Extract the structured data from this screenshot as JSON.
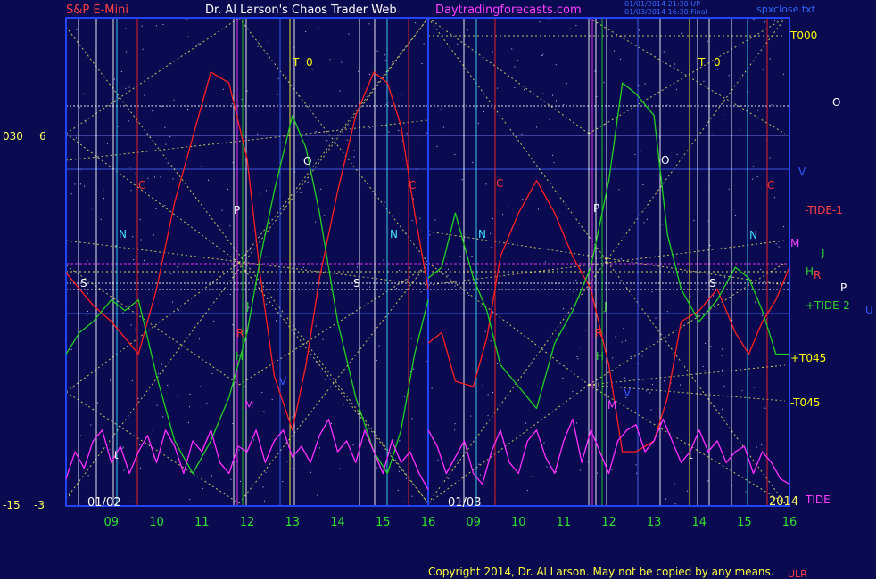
{
  "header": {
    "instrument": "S&P E-Mini",
    "site_title": "Dr. Al Larson's Chaos Trader Web",
    "site_url": "Daytradingforecasts.com",
    "stamp_line1": "01/01/2014 21:30 UP",
    "stamp_line2": "01/03/2014 16:30 Final",
    "file_name": "spxclose.txt"
  },
  "footer": {
    "copyright": "Copyright 2014, Dr. Al Larson. May not be copied by any means."
  },
  "colors": {
    "background": "#0a0a50",
    "axes": "#2244ff",
    "price": "#ff2020",
    "flux": "#20d020",
    "tide": "#ff30ff",
    "grid_lines": "#ffff60"
  },
  "left_axis": {
    "top_outer": "030",
    "top_inner": "6",
    "bottom_outer": "-15",
    "bottom_inner": "-3"
  },
  "session_labels": [
    "01/02",
    "01/03"
  ],
  "year_label": "2014",
  "corner_label": "ULR",
  "right_labels": [
    {
      "text": "T000",
      "color": "#ffff00"
    },
    {
      "text": "O",
      "color": "#ffffff"
    },
    {
      "text": "V",
      "color": "#3355ff"
    },
    {
      "text": "-TIDE-1",
      "color": "#ff4040"
    },
    {
      "text": "M",
      "color": "#ff40ff"
    },
    {
      "text": "J",
      "color": "#30d030"
    },
    {
      "text": "H",
      "color": "#30d030"
    },
    {
      "text": "R",
      "color": "#ff4040"
    },
    {
      "text": "P",
      "color": "#ffffff"
    },
    {
      "text": "+TIDE-2",
      "color": "#30d030"
    },
    {
      "text": "U",
      "color": "#3355ff"
    },
    {
      "text": "+T045",
      "color": "#ffff00"
    },
    {
      "text": "-T045",
      "color": "#ffff00"
    },
    {
      "text": "TIDE",
      "color": "#ff40ff"
    }
  ],
  "marker_labels": [
    {
      "text": "S&P E-Mini"
    },
    {
      "text": "T",
      "color": "#ffff00"
    },
    {
      "text": "0",
      "color": "#ffff00"
    },
    {
      "text": "T",
      "color": "#ffff00"
    },
    {
      "text": "0",
      "color": "#ffff00"
    },
    {
      "text": "O",
      "color": "#ffffff"
    },
    {
      "text": "O",
      "color": "#ffffff"
    },
    {
      "text": "C",
      "color": "#ff3030"
    },
    {
      "text": "C",
      "color": "#ff3030"
    },
    {
      "text": "C",
      "color": "#ff3030"
    },
    {
      "text": "C",
      "color": "#ff3030"
    },
    {
      "text": "P",
      "color": "#ffffff"
    },
    {
      "text": "P",
      "color": "#ffffff"
    },
    {
      "text": "N",
      "color": "#40e0ff"
    },
    {
      "text": "N",
      "color": "#40e0ff"
    },
    {
      "text": "N",
      "color": "#40e0ff"
    },
    {
      "text": "N",
      "color": "#40e0ff"
    },
    {
      "text": "S",
      "color": "#ffffff"
    },
    {
      "text": "S",
      "color": "#ffffff"
    },
    {
      "text": "S",
      "color": "#ffffff"
    },
    {
      "text": "J",
      "color": "#30d030"
    },
    {
      "text": "J",
      "color": "#30d030"
    },
    {
      "text": "R",
      "color": "#ff3030"
    },
    {
      "text": "R",
      "color": "#ff3030"
    },
    {
      "text": "H",
      "color": "#30d030"
    },
    {
      "text": "H",
      "color": "#30d030"
    },
    {
      "text": "M",
      "color": "#ff40ff"
    },
    {
      "text": "M",
      "color": "#ff40ff"
    },
    {
      "text": "V",
      "color": "#3355ff"
    },
    {
      "text": "V",
      "color": "#3355ff"
    },
    {
      "text": "t",
      "color": "#ffffff"
    },
    {
      "text": "t",
      "color": "#ffffff"
    }
  ],
  "chart_data": {
    "type": "line",
    "x_ticks": [
      "09",
      "10",
      "11",
      "12",
      "13",
      "14",
      "15",
      "16",
      "09",
      "10",
      "11",
      "12",
      "13",
      "14",
      "15",
      "16"
    ],
    "sessions": [
      "01/02",
      "01/03"
    ],
    "ylim": [
      -15,
      30
    ],
    "series": [
      {
        "name": "TIDE-1",
        "color": "#ff2020",
        "x": [
          8.0,
          8.3,
          8.6,
          9.0,
          9.3,
          9.6,
          10.0,
          10.4,
          10.8,
          11.2,
          11.6,
          12.0,
          12.3,
          12.6,
          13.0,
          13.3,
          13.6,
          14.0,
          14.4,
          14.8,
          15.1,
          15.4,
          15.7,
          16.0
        ],
        "y": [
          6.5,
          5,
          3.5,
          2,
          0.5,
          -1,
          5,
          13,
          19,
          25,
          24,
          17,
          6,
          -3,
          -8,
          -2,
          6,
          14,
          21,
          25,
          24,
          20,
          12,
          5
        ]
      },
      {
        "name": "TIDE-1 (01/03)",
        "color": "#ff2020",
        "x": [
          8.0,
          8.3,
          8.6,
          9.0,
          9.3,
          9.6,
          10.0,
          10.4,
          10.8,
          11.2,
          11.6,
          12.0,
          12.3,
          12.6,
          13.0,
          13.3,
          13.6,
          14.0,
          14.4,
          14.8,
          15.1,
          15.4,
          15.7,
          16.0
        ],
        "y": [
          0,
          1,
          -3.5,
          -4,
          0.5,
          8,
          12,
          15,
          12,
          8,
          5,
          -2,
          -10,
          -10,
          -9,
          -5,
          2,
          3,
          5,
          1,
          -1,
          2,
          4,
          7
        ]
      },
      {
        "name": "TIDE-2",
        "color": "#20d020",
        "x": [
          8.0,
          8.3,
          8.6,
          9.0,
          9.3,
          9.6,
          10.0,
          10.4,
          10.8,
          11.2,
          11.6,
          12.0,
          12.3,
          12.6,
          13.0,
          13.3,
          13.6,
          14.0,
          14.4,
          14.8,
          15.1,
          15.4,
          15.7,
          16.0
        ],
        "y": [
          -1,
          1,
          2,
          4,
          3,
          4,
          -3,
          -9,
          -12,
          -9,
          -5,
          1,
          8,
          14,
          21,
          18,
          12,
          2,
          -5,
          -10,
          -12,
          -8,
          -1,
          4
        ]
      },
      {
        "name": "TIDE-2 (01/03)",
        "color": "#20d020",
        "x": [
          8.0,
          8.3,
          8.6,
          9.0,
          9.3,
          9.6,
          10.0,
          10.4,
          10.8,
          11.2,
          11.6,
          12.0,
          12.3,
          12.6,
          13.0,
          13.3,
          13.6,
          14.0,
          14.4,
          14.8,
          15.1,
          15.4,
          15.7,
          16.0
        ],
        "y": [
          6,
          7,
          12,
          6,
          3,
          -2,
          -4,
          -6,
          0,
          3,
          7,
          15,
          24,
          23,
          21,
          10,
          5,
          2,
          4,
          7,
          6,
          3,
          -1,
          -1
        ]
      },
      {
        "name": "TIDE",
        "color": "#ff30ff",
        "x": [
          8.0,
          8.2,
          8.4,
          8.6,
          8.8,
          9.0,
          9.2,
          9.4,
          9.6,
          9.8,
          10.0,
          10.2,
          10.4,
          10.6,
          10.8,
          11.0,
          11.2,
          11.4,
          11.6,
          11.8,
          12.0,
          12.2,
          12.4,
          12.6,
          12.8,
          13.0,
          13.2,
          13.4,
          13.6,
          13.8,
          14.0,
          14.2,
          14.4,
          14.6,
          14.8,
          15.0,
          15.2,
          15.4,
          15.6,
          15.8,
          16.0
        ],
        "y": [
          -12.5,
          -10,
          -11.5,
          -9,
          -8,
          -11,
          -9.5,
          -12,
          -10,
          -8.5,
          -11,
          -8,
          -9.5,
          -12,
          -9,
          -10,
          -8,
          -11,
          -12,
          -9.5,
          -10,
          -8,
          -11,
          -9,
          -8,
          -10.5,
          -9.5,
          -11,
          -8.5,
          -7,
          -10,
          -9,
          -11,
          -8,
          -10,
          -12,
          -9,
          -11,
          -10,
          -12,
          -13.5
        ]
      },
      {
        "name": "TIDE (01/03)",
        "color": "#ff30ff",
        "x": [
          8.0,
          8.2,
          8.4,
          8.6,
          8.8,
          9.0,
          9.2,
          9.4,
          9.6,
          9.8,
          10.0,
          10.2,
          10.4,
          10.6,
          10.8,
          11.0,
          11.2,
          11.4,
          11.6,
          11.8,
          12.0,
          12.2,
          12.4,
          12.6,
          12.8,
          13.0,
          13.2,
          13.4,
          13.6,
          13.8,
          14.0,
          14.2,
          14.4,
          14.6,
          14.8,
          15.0,
          15.2,
          15.4,
          15.6,
          15.8,
          16.0
        ],
        "y": [
          -8,
          -9.5,
          -12,
          -10.5,
          -9,
          -12,
          -13,
          -10,
          -8,
          -11,
          -12,
          -9,
          -8,
          -10.5,
          -12,
          -9,
          -7,
          -11,
          -8,
          -10,
          -12,
          -9,
          -8,
          -7.5,
          -10,
          -9,
          -7,
          -9,
          -11,
          -10,
          -8,
          -10,
          -9,
          -11,
          -10,
          -9.5,
          -12,
          -10,
          -11,
          -12.5,
          -13
        ]
      }
    ]
  }
}
